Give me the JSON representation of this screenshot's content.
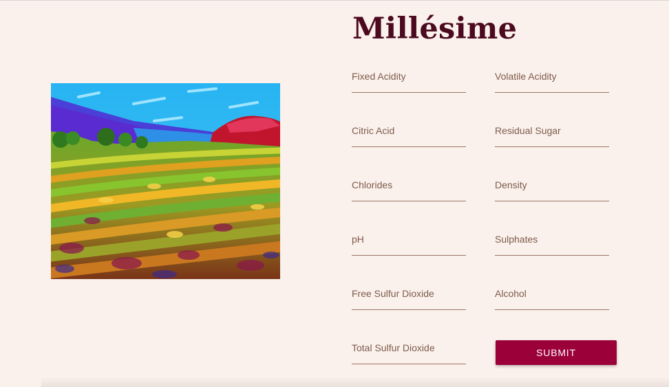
{
  "app": {
    "title": "Millésime"
  },
  "image": {
    "icon": "vineyard-painting"
  },
  "form": {
    "fields": [
      {
        "label": "Fixed Acidity",
        "value": ""
      },
      {
        "label": "Volatile Acidity",
        "value": ""
      },
      {
        "label": "Citric Acid",
        "value": ""
      },
      {
        "label": "Residual Sugar",
        "value": ""
      },
      {
        "label": "Chlorides",
        "value": ""
      },
      {
        "label": "Density",
        "value": ""
      },
      {
        "label": "pH",
        "value": ""
      },
      {
        "label": "Sulphates",
        "value": ""
      },
      {
        "label": "Free Sulfur Dioxide",
        "value": ""
      },
      {
        "label": "Alcohol",
        "value": ""
      },
      {
        "label": "Total Sulfur Dioxide",
        "value": ""
      }
    ],
    "submit_label": "SUBMIT"
  },
  "colors": {
    "background": "#fbf1ec",
    "title": "#4b0a1f",
    "label": "#7d5a4b",
    "underline": "#9a7263",
    "button": "#9b0038",
    "button_text": "#ffffff"
  }
}
